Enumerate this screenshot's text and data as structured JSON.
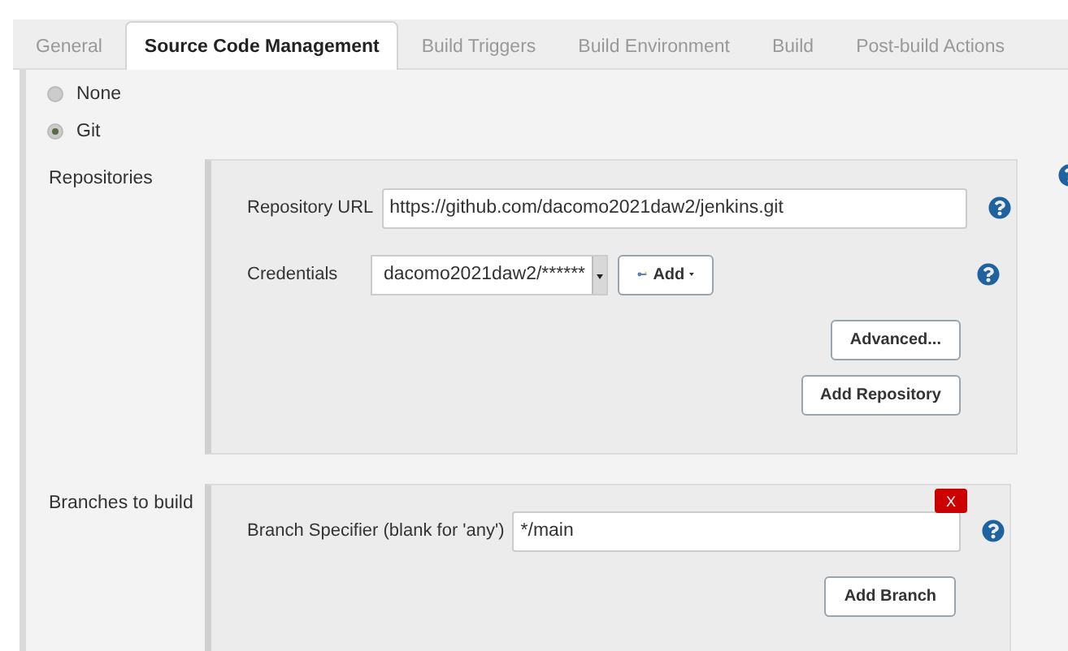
{
  "tabs": [
    {
      "label": "General",
      "selected": false
    },
    {
      "label": "Source Code Management",
      "selected": true
    },
    {
      "label": "Build Triggers",
      "selected": false
    },
    {
      "label": "Build Environment",
      "selected": false
    },
    {
      "label": "Build",
      "selected": false
    },
    {
      "label": "Post-build Actions",
      "selected": false
    }
  ],
  "scm_options": [
    {
      "label": "None",
      "selected": false
    },
    {
      "label": "Git",
      "selected": true
    }
  ],
  "repositories": {
    "label": "Repositories",
    "url_label": "Repository URL",
    "url": "https://github.com/dacomo2021daw2/jenkins.git",
    "credentials_label": "Credentials",
    "credentials": "dacomo2021daw2/******",
    "add_button": "Add",
    "advanced_button": "Advanced...",
    "add_repository_button": "Add Repository"
  },
  "branches": {
    "label": "Branches to build",
    "delete_button": "X",
    "specifier_label": "Branch Specifier (blank for 'any')",
    "specifier": "*/main",
    "add_branch_button": "Add Branch"
  }
}
